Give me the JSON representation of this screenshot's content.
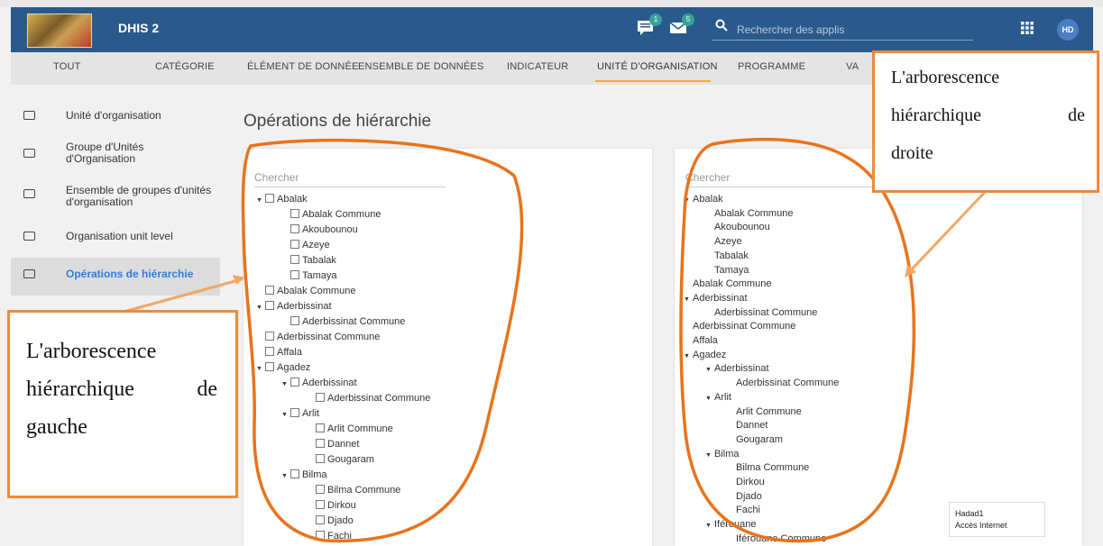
{
  "header": {
    "app_title": "DHIS 2",
    "messages_badge": "1",
    "mail_badge": "5",
    "search_placeholder": "Rechercher des applis",
    "avatar_initials": "HD"
  },
  "tabs": [
    {
      "label": "TOUT"
    },
    {
      "label": "CATÉGORIE"
    },
    {
      "label": "ÉLÉMENT DE DONNÉE"
    },
    {
      "label": "ENSEMBLE DE DONNÉES"
    },
    {
      "label": "INDICATEUR"
    },
    {
      "label": "UNITÉ D'ORGANISATION",
      "active": true
    },
    {
      "label": "PROGRAMME"
    },
    {
      "label": "VA"
    }
  ],
  "sidebar": {
    "items": [
      {
        "label": "Unité d'organisation"
      },
      {
        "label": "Groupe d'Unités d'Organisation"
      },
      {
        "label": "Ensemble de groupes d'unités d'organisation"
      },
      {
        "label": "Organisation unit level"
      },
      {
        "label": "Opérations de hiérarchie",
        "active": true
      }
    ]
  },
  "main": {
    "title": "Opérations de hiérarchie",
    "left_search_placeholder": "Chercher",
    "right_search_placeholder": "Chercher"
  },
  "left_tree": [
    {
      "label": "Abalak",
      "depth": 0,
      "expanded": true
    },
    {
      "label": "Abalak Commune",
      "depth": 1
    },
    {
      "label": "Akoubounou",
      "depth": 1
    },
    {
      "label": "Azeye",
      "depth": 1
    },
    {
      "label": "Tabalak",
      "depth": 1
    },
    {
      "label": "Tamaya",
      "depth": 1
    },
    {
      "label": "Abalak Commune",
      "depth": 0
    },
    {
      "label": "Aderbissinat",
      "depth": 0,
      "expanded": true
    },
    {
      "label": "Aderbissinat Commune",
      "depth": 1
    },
    {
      "label": "Aderbissinat Commune",
      "depth": 0
    },
    {
      "label": "Affala",
      "depth": 0
    },
    {
      "label": "Agadez",
      "depth": 0,
      "expanded": true
    },
    {
      "label": "Aderbissinat",
      "depth": 1,
      "expanded": true
    },
    {
      "label": "Aderbissinat Commune",
      "depth": 2
    },
    {
      "label": "Arlit",
      "depth": 1,
      "expanded": true
    },
    {
      "label": "Arlit Commune",
      "depth": 2
    },
    {
      "label": "Dannet",
      "depth": 2
    },
    {
      "label": "Gougaram",
      "depth": 2
    },
    {
      "label": "Bilma",
      "depth": 1,
      "expanded": true
    },
    {
      "label": "Bilma Commune",
      "depth": 2
    },
    {
      "label": "Dirkou",
      "depth": 2
    },
    {
      "label": "Djado",
      "depth": 2
    },
    {
      "label": "Fachi",
      "depth": 2
    }
  ],
  "right_tree": [
    {
      "label": "Abalak",
      "depth": 0,
      "expanded": true
    },
    {
      "label": "Abalak Commune",
      "depth": 1
    },
    {
      "label": "Akoubounou",
      "depth": 1
    },
    {
      "label": "Azeye",
      "depth": 1
    },
    {
      "label": "Tabalak",
      "depth": 1
    },
    {
      "label": "Tamaya",
      "depth": 1
    },
    {
      "label": "Abalak Commune",
      "depth": 0
    },
    {
      "label": "Aderbissinat",
      "depth": 0,
      "expanded": true
    },
    {
      "label": "Aderbissinat Commune",
      "depth": 1
    },
    {
      "label": "Aderbissinat Commune",
      "depth": 0
    },
    {
      "label": "Affala",
      "depth": 0
    },
    {
      "label": "Agadez",
      "depth": 0,
      "expanded": true
    },
    {
      "label": "Aderbissinat",
      "depth": 1,
      "expanded": true
    },
    {
      "label": "Aderbissinat Commune",
      "depth": 2
    },
    {
      "label": "Arlit",
      "depth": 1,
      "expanded": true
    },
    {
      "label": "Arlit Commune",
      "depth": 2
    },
    {
      "label": "Dannet",
      "depth": 2
    },
    {
      "label": "Gougaram",
      "depth": 2
    },
    {
      "label": "Bilma",
      "depth": 1,
      "expanded": true
    },
    {
      "label": "Bilma Commune",
      "depth": 2
    },
    {
      "label": "Dirkou",
      "depth": 2
    },
    {
      "label": "Djado",
      "depth": 2
    },
    {
      "label": "Fachi",
      "depth": 2
    },
    {
      "label": "Iférouane",
      "depth": 1,
      "expanded": true
    },
    {
      "label": "Iférouane Commune",
      "depth": 2
    }
  ],
  "callouts": {
    "right": {
      "lines": [
        "L'arborescence",
        "hiérarchique de",
        "droite"
      ]
    },
    "left": {
      "lines": [
        "L'arborescence",
        "hiérarchique de",
        "gauche"
      ]
    }
  },
  "tooltip": {
    "line1": "Hadad1",
    "line2": "Accès Internet"
  },
  "colors": {
    "header_bg": "#2a5a8c",
    "accent": "#f2a93b",
    "annotation": "#ee8a3a",
    "active_link": "#2d7ee0"
  }
}
